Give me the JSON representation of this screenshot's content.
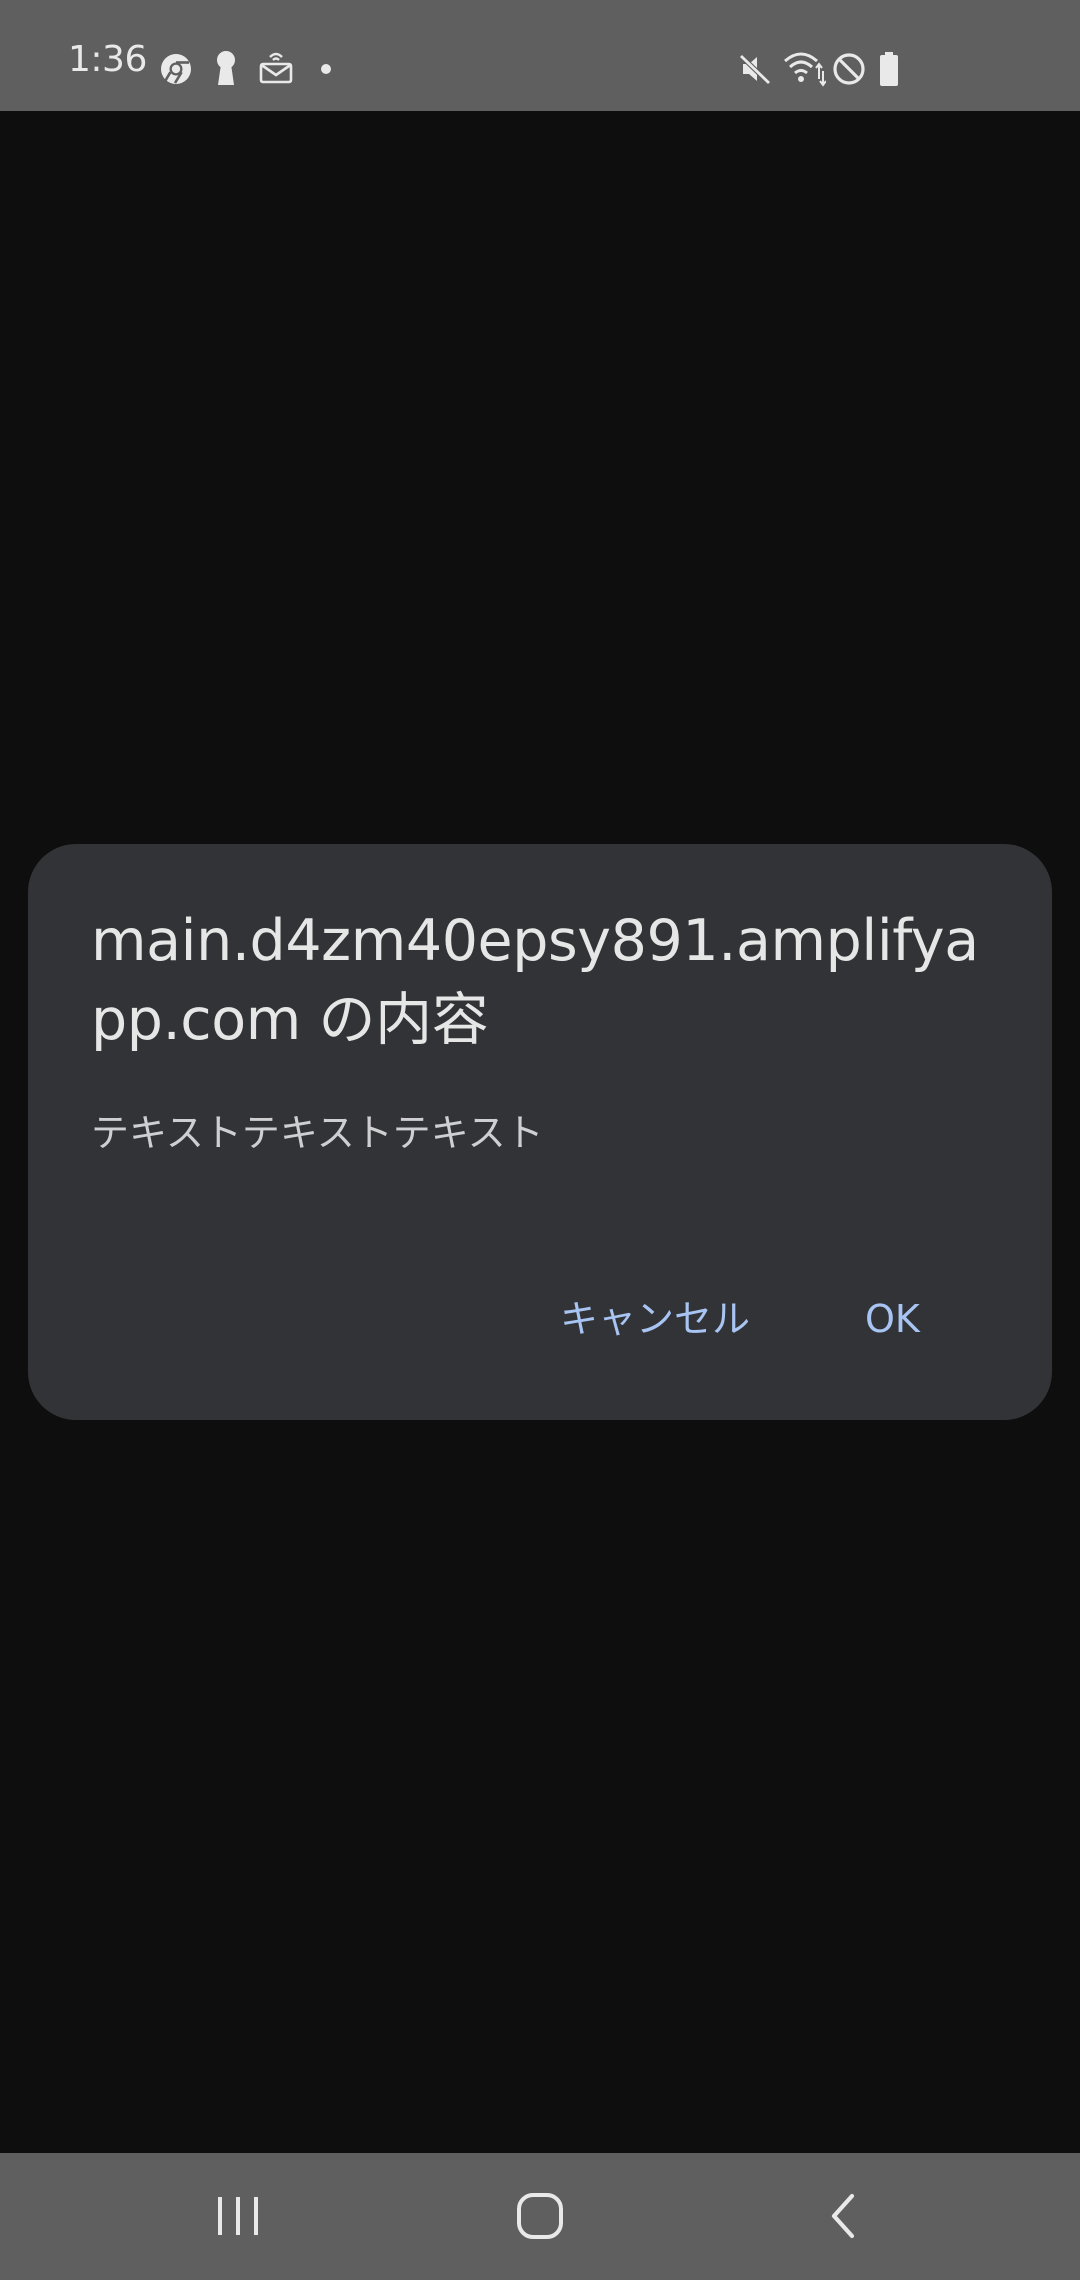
{
  "status_bar": {
    "time": "1:36",
    "left_icons": [
      "chrome-icon",
      "keyhole-icon",
      "mail-icon",
      "notification-dot-icon"
    ],
    "right_icons": [
      "mute-icon",
      "wifi-icon",
      "do-not-disturb-icon",
      "battery-icon"
    ]
  },
  "dialog": {
    "title": "main.d4zm40epsy891.amplifyapp.com の内容",
    "message": "テキストテキストテキスト",
    "cancel_label": "キャンセル",
    "ok_label": "OK"
  },
  "nav_bar": {
    "buttons": [
      "recents-icon",
      "home-icon",
      "back-icon"
    ]
  },
  "colors": {
    "status_bar_bg": "#5f5f5f",
    "screen_bg": "#0e0e0f",
    "dialog_bg": "#323337",
    "dialog_title": "#e6e6e6",
    "dialog_message": "#cfcfd2",
    "button_accent": "#a8c4f2"
  }
}
